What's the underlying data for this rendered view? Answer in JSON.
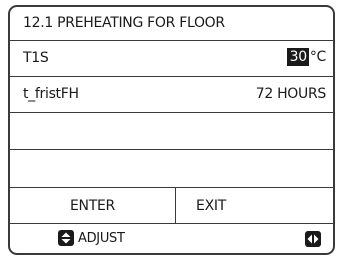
{
  "header": {
    "title": "12.1 PREHEATING FOR FLOOR"
  },
  "params": [
    {
      "label": "T1S",
      "value": "30",
      "unit": "°C"
    },
    {
      "label": "t_fristFH",
      "value": "72 HOURS"
    }
  ],
  "buttons": {
    "enter": "ENTER",
    "exit": "EXIT"
  },
  "footer": {
    "adjust_label": "ADJUST",
    "adjust_icon": "up-down-arrows-icon",
    "nav_icon": "left-right-arrows-icon"
  },
  "colors": {
    "border": "#3a3a3a",
    "highlight_bg": "#1a1a1a",
    "highlight_fg": "#ffffff"
  }
}
